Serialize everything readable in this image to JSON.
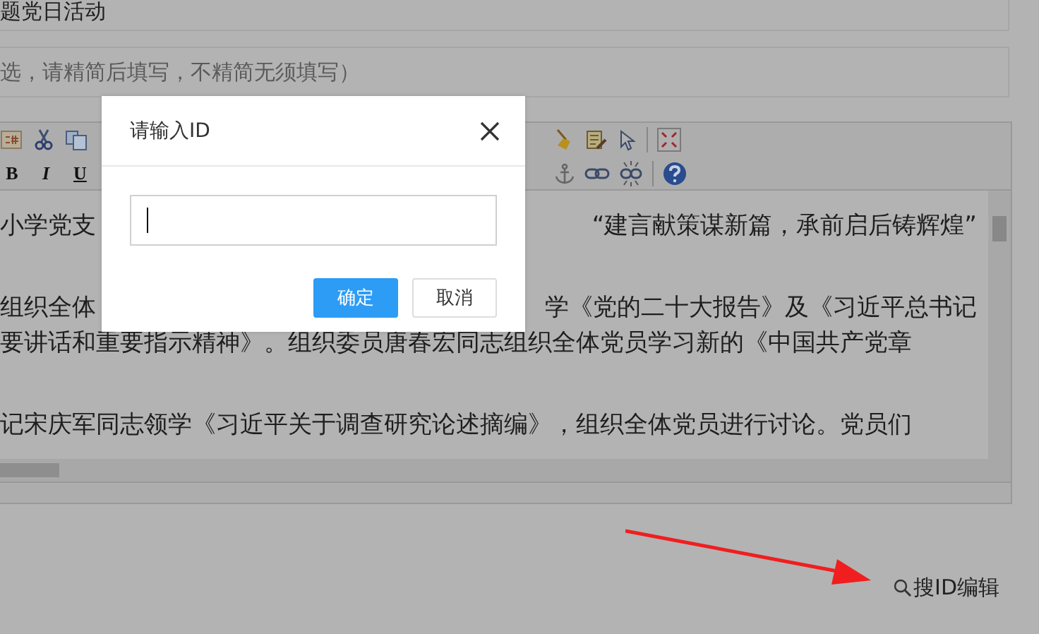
{
  "form": {
    "title_field": {
      "value": "题党日活动"
    },
    "summary_field": {
      "placeholder": "选，请精简后填写，不精简无须填写）"
    }
  },
  "editor": {
    "format_buttons": [
      "B",
      "I",
      "U"
    ],
    "paragraphs": [
      {
        "lines": [
          [
            "小学党支",
            "“建言献策谋新篇，承前启后铸辉煌”"
          ]
        ]
      },
      {
        "lines": [
          [
            "组织全体",
            "学《党的二十大报告》及《习近平总书记"
          ],
          [
            "要讲话和重要指示精神》。组织委员唐春宏同志组织全体党员学习新的《中国共产党章"
          ]
        ]
      },
      {
        "lines": [
          [
            "记宋庆军同志领学《习近平关于调查研究论述摘编》，组织全体党员进行讨论。党员们"
          ]
        ]
      }
    ]
  },
  "search_link": {
    "label": "搜ID编辑"
  },
  "dialog": {
    "title": "请输入ID",
    "input": {
      "focused": true
    },
    "buttons": [
      {
        "label": "确定",
        "kind": "primary"
      },
      {
        "label": "取消",
        "kind": "default"
      }
    ]
  }
}
